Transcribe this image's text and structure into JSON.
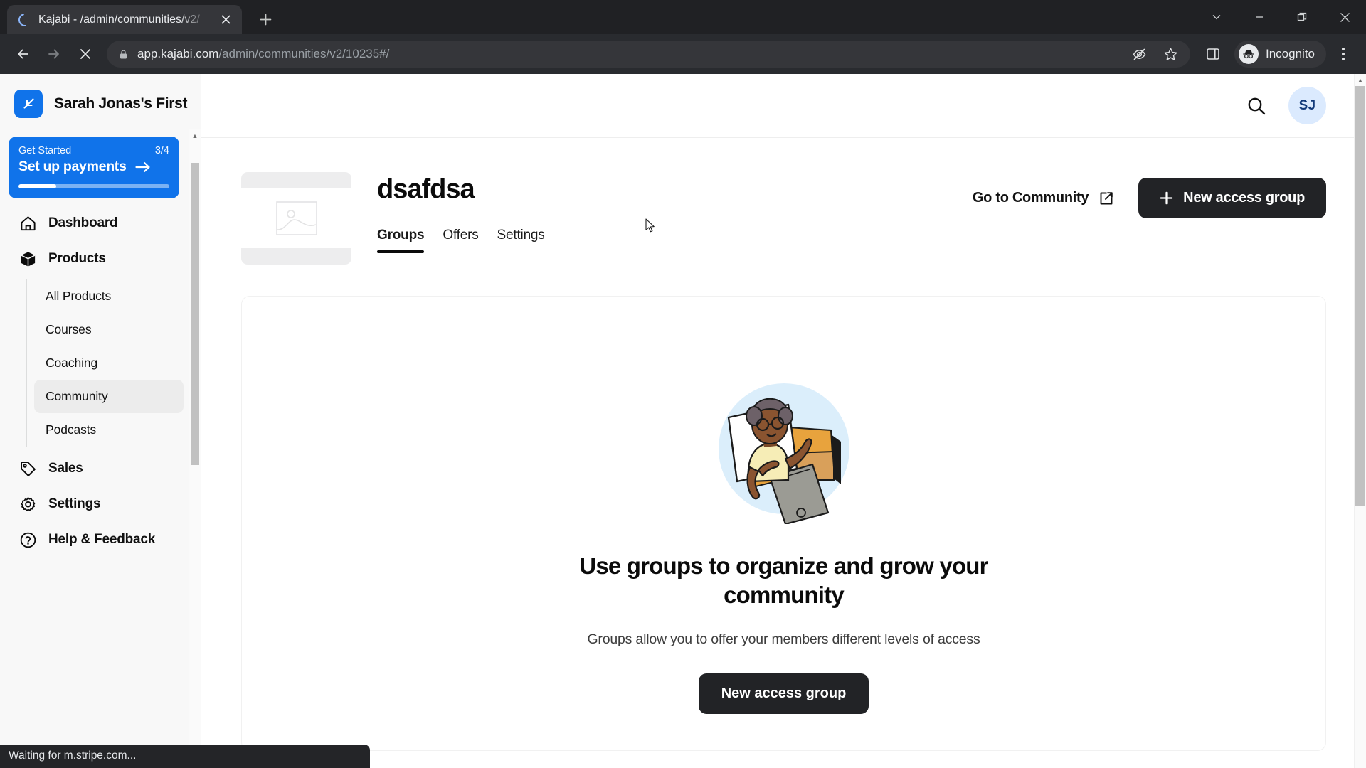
{
  "browser": {
    "tab": {
      "title": "Kajabi - /admin/communities/v2/",
      "spinner_icon": "loading-spinner",
      "close_icon": "close-icon"
    },
    "new_tab_label": "+",
    "window_controls": [
      {
        "name": "minimize-to-tray",
        "icon": "chevron-down-icon"
      },
      {
        "name": "minimize",
        "icon": "minimize-icon"
      },
      {
        "name": "maximize",
        "icon": "restore-icon"
      },
      {
        "name": "close",
        "icon": "close-icon"
      }
    ],
    "toolbar": {
      "back_icon": "back-arrow-icon",
      "forward_icon": "forward-arrow-icon",
      "stop_icon": "stop-loading-icon",
      "lock_icon": "lock-icon",
      "url_domain": "app.kajabi.com",
      "url_path": "/admin/communities/v2/10235#/",
      "tracking_icon": "eye-crossed-icon",
      "bookmark_icon": "star-icon",
      "sidepanel_icon": "side-panel-icon",
      "incognito_label": "Incognito",
      "incognito_icon": "incognito-hat-icon",
      "menu_icon": "kebab-menu-icon"
    },
    "status_text": "Waiting for m.stripe.com..."
  },
  "sidebar": {
    "brand_name": "Sarah Jonas's First",
    "brand_icon": "kajabi-logo-icon",
    "get_started": {
      "label": "Get Started",
      "count": "3/4",
      "title": "Set up payments",
      "arrow_icon": "arrow-right-icon",
      "progress_percent": 25
    },
    "items": [
      {
        "label": "Dashboard",
        "icon": "home-icon",
        "active": false
      },
      {
        "label": "Products",
        "icon": "box-icon",
        "active": false
      },
      {
        "label": "Sales",
        "icon": "tag-icon",
        "active": false
      },
      {
        "label": "Settings",
        "icon": "gear-icon",
        "active": false
      },
      {
        "label": "Help & Feedback",
        "icon": "question-circle-icon",
        "active": false
      }
    ],
    "products_subitems": [
      {
        "label": "All Products",
        "active": false
      },
      {
        "label": "Courses",
        "active": false
      },
      {
        "label": "Coaching",
        "active": false
      },
      {
        "label": "Community",
        "active": true
      },
      {
        "label": "Podcasts",
        "active": false
      }
    ]
  },
  "topbar": {
    "search_icon": "search-icon",
    "avatar_initials": "SJ"
  },
  "product": {
    "title": "dsafdsa",
    "thumbnail_icon": "image-placeholder-icon",
    "tabs": [
      {
        "label": "Groups",
        "active": true
      },
      {
        "label": "Offers",
        "active": false
      },
      {
        "label": "Settings",
        "active": false
      }
    ],
    "go_to_community_label": "Go to Community",
    "external_link_icon": "external-link-icon",
    "new_access_group_label": "New access group",
    "plus_icon": "plus-icon"
  },
  "empty_state": {
    "illustration": "person-with-folders-illustration",
    "title": "Use groups to organize and grow your community",
    "subtitle": "Groups allow you to offer your members different levels of access",
    "button_label": "New access group"
  },
  "colors": {
    "brand_blue": "#1073ea",
    "primary_dark": "#222326",
    "avatar_bg": "#dbeafe",
    "avatar_fg": "#123a7a",
    "sidebar_bg": "#f8f8f8"
  }
}
